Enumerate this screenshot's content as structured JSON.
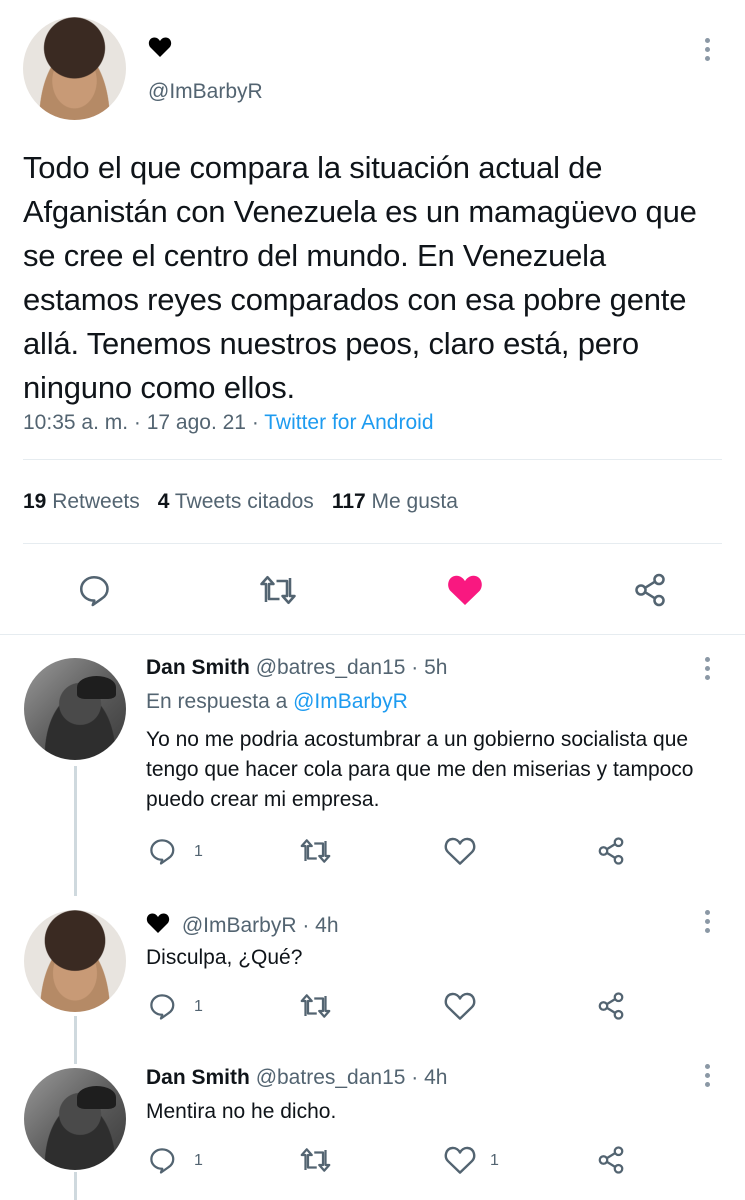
{
  "main_tweet": {
    "display_name_emoji": "🖤",
    "handle": "@ImBarbyR",
    "text": "Todo el que compara la situación actual de Afganistán con Venezuela es un mamagüevo que se cree el centro del mundo. En Venezuela estamos reyes comparados con esa pobre gente allá. Tenemos nuestros peos, claro está, pero ninguno como ellos.",
    "timestamp": "10:35 a. m. · 17 ago. 21 · ",
    "source": "Twitter for Android",
    "stats": {
      "retweets_count": "19",
      "retweets_label": "Retweets",
      "quotes_count": "4",
      "quotes_label": "Tweets citados",
      "likes_count": "117",
      "likes_label": "Me gusta"
    },
    "liked": true
  },
  "replies": [
    {
      "name": "Dan Smith",
      "handle": "@batres_dan15",
      "time": " · 5h",
      "reply_prefix": "En respuesta a ",
      "reply_to": "@ImBarbyR",
      "text": "Yo no me podria acostumbrar a un gobierno socialista que tengo que hacer cola para que me den miserias y tampoco puedo crear mi empresa.",
      "reply_count": "1",
      "like_count": ""
    },
    {
      "name": "🖤",
      "handle": "@ImBarbyR",
      "time": " · 4h",
      "text": "Disculpa, ¿Qué?",
      "reply_count": "1",
      "like_count": ""
    },
    {
      "name": "Dan Smith",
      "handle": "@batres_dan15",
      "time": " · 4h",
      "text": "Mentira no he dicho.",
      "reply_count": "1",
      "like_count": "1"
    }
  ],
  "colors": {
    "accent": "#1d9bf0",
    "like": "#f91880",
    "muted": "#536471"
  }
}
